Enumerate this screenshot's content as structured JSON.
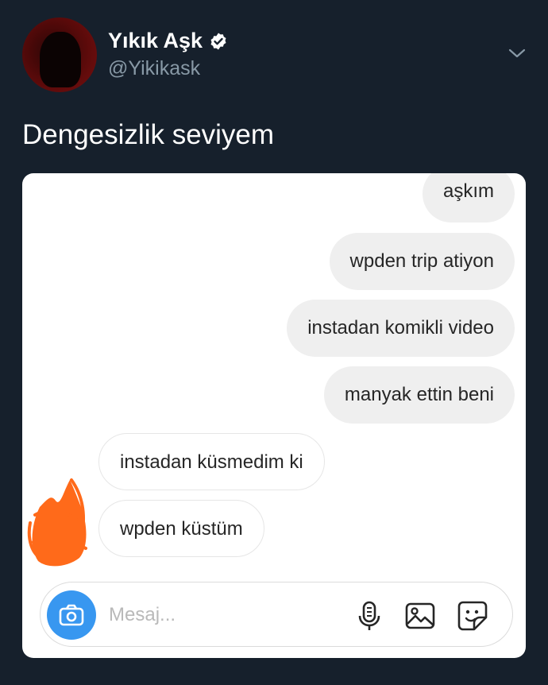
{
  "author": {
    "display_name": "Yıkık Aşk",
    "handle": "@Yikikask",
    "verified": true,
    "avatar_icon": "avatar-silhouette"
  },
  "tweet": {
    "text": "Dengesizlik seviyem",
    "menu_icon": "chevron-down-icon"
  },
  "chat": {
    "messages": [
      {
        "from": "me",
        "text": "aşkım"
      },
      {
        "from": "me",
        "text": "wpden trip atiyon"
      },
      {
        "from": "me",
        "text": "instadan komikli video"
      },
      {
        "from": "me",
        "text": "manyak ettin beni"
      },
      {
        "from": "them",
        "text": "instadan küsmedim ki"
      },
      {
        "from": "them",
        "text": "wpden küstüm"
      }
    ],
    "composer": {
      "placeholder": "Mesaj...",
      "icons": [
        "camera-icon",
        "microphone-icon",
        "gallery-icon",
        "sticker-icon"
      ]
    }
  },
  "colors": {
    "background": "#16202c",
    "accent": "#3897f0",
    "sent_bubble": "#efefef",
    "scribble": "#ff6a1a"
  }
}
